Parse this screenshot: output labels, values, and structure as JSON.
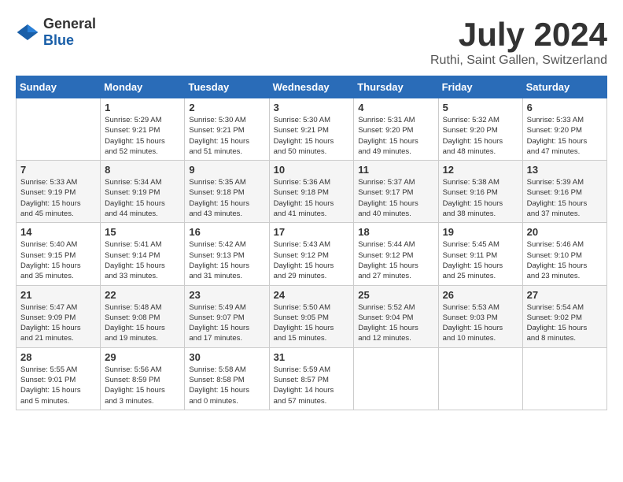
{
  "logo": {
    "general": "General",
    "blue": "Blue"
  },
  "title": "July 2024",
  "location": "Ruthi, Saint Gallen, Switzerland",
  "weekdays": [
    "Sunday",
    "Monday",
    "Tuesday",
    "Wednesday",
    "Thursday",
    "Friday",
    "Saturday"
  ],
  "weeks": [
    [
      {
        "day": "",
        "info": ""
      },
      {
        "day": "1",
        "info": "Sunrise: 5:29 AM\nSunset: 9:21 PM\nDaylight: 15 hours\nand 52 minutes."
      },
      {
        "day": "2",
        "info": "Sunrise: 5:30 AM\nSunset: 9:21 PM\nDaylight: 15 hours\nand 51 minutes."
      },
      {
        "day": "3",
        "info": "Sunrise: 5:30 AM\nSunset: 9:21 PM\nDaylight: 15 hours\nand 50 minutes."
      },
      {
        "day": "4",
        "info": "Sunrise: 5:31 AM\nSunset: 9:20 PM\nDaylight: 15 hours\nand 49 minutes."
      },
      {
        "day": "5",
        "info": "Sunrise: 5:32 AM\nSunset: 9:20 PM\nDaylight: 15 hours\nand 48 minutes."
      },
      {
        "day": "6",
        "info": "Sunrise: 5:33 AM\nSunset: 9:20 PM\nDaylight: 15 hours\nand 47 minutes."
      }
    ],
    [
      {
        "day": "7",
        "info": "Sunrise: 5:33 AM\nSunset: 9:19 PM\nDaylight: 15 hours\nand 45 minutes."
      },
      {
        "day": "8",
        "info": "Sunrise: 5:34 AM\nSunset: 9:19 PM\nDaylight: 15 hours\nand 44 minutes."
      },
      {
        "day": "9",
        "info": "Sunrise: 5:35 AM\nSunset: 9:18 PM\nDaylight: 15 hours\nand 43 minutes."
      },
      {
        "day": "10",
        "info": "Sunrise: 5:36 AM\nSunset: 9:18 PM\nDaylight: 15 hours\nand 41 minutes."
      },
      {
        "day": "11",
        "info": "Sunrise: 5:37 AM\nSunset: 9:17 PM\nDaylight: 15 hours\nand 40 minutes."
      },
      {
        "day": "12",
        "info": "Sunrise: 5:38 AM\nSunset: 9:16 PM\nDaylight: 15 hours\nand 38 minutes."
      },
      {
        "day": "13",
        "info": "Sunrise: 5:39 AM\nSunset: 9:16 PM\nDaylight: 15 hours\nand 37 minutes."
      }
    ],
    [
      {
        "day": "14",
        "info": "Sunrise: 5:40 AM\nSunset: 9:15 PM\nDaylight: 15 hours\nand 35 minutes."
      },
      {
        "day": "15",
        "info": "Sunrise: 5:41 AM\nSunset: 9:14 PM\nDaylight: 15 hours\nand 33 minutes."
      },
      {
        "day": "16",
        "info": "Sunrise: 5:42 AM\nSunset: 9:13 PM\nDaylight: 15 hours\nand 31 minutes."
      },
      {
        "day": "17",
        "info": "Sunrise: 5:43 AM\nSunset: 9:12 PM\nDaylight: 15 hours\nand 29 minutes."
      },
      {
        "day": "18",
        "info": "Sunrise: 5:44 AM\nSunset: 9:12 PM\nDaylight: 15 hours\nand 27 minutes."
      },
      {
        "day": "19",
        "info": "Sunrise: 5:45 AM\nSunset: 9:11 PM\nDaylight: 15 hours\nand 25 minutes."
      },
      {
        "day": "20",
        "info": "Sunrise: 5:46 AM\nSunset: 9:10 PM\nDaylight: 15 hours\nand 23 minutes."
      }
    ],
    [
      {
        "day": "21",
        "info": "Sunrise: 5:47 AM\nSunset: 9:09 PM\nDaylight: 15 hours\nand 21 minutes."
      },
      {
        "day": "22",
        "info": "Sunrise: 5:48 AM\nSunset: 9:08 PM\nDaylight: 15 hours\nand 19 minutes."
      },
      {
        "day": "23",
        "info": "Sunrise: 5:49 AM\nSunset: 9:07 PM\nDaylight: 15 hours\nand 17 minutes."
      },
      {
        "day": "24",
        "info": "Sunrise: 5:50 AM\nSunset: 9:05 PM\nDaylight: 15 hours\nand 15 minutes."
      },
      {
        "day": "25",
        "info": "Sunrise: 5:52 AM\nSunset: 9:04 PM\nDaylight: 15 hours\nand 12 minutes."
      },
      {
        "day": "26",
        "info": "Sunrise: 5:53 AM\nSunset: 9:03 PM\nDaylight: 15 hours\nand 10 minutes."
      },
      {
        "day": "27",
        "info": "Sunrise: 5:54 AM\nSunset: 9:02 PM\nDaylight: 15 hours\nand 8 minutes."
      }
    ],
    [
      {
        "day": "28",
        "info": "Sunrise: 5:55 AM\nSunset: 9:01 PM\nDaylight: 15 hours\nand 5 minutes."
      },
      {
        "day": "29",
        "info": "Sunrise: 5:56 AM\nSunset: 8:59 PM\nDaylight: 15 hours\nand 3 minutes."
      },
      {
        "day": "30",
        "info": "Sunrise: 5:58 AM\nSunset: 8:58 PM\nDaylight: 15 hours\nand 0 minutes."
      },
      {
        "day": "31",
        "info": "Sunrise: 5:59 AM\nSunset: 8:57 PM\nDaylight: 14 hours\nand 57 minutes."
      },
      {
        "day": "",
        "info": ""
      },
      {
        "day": "",
        "info": ""
      },
      {
        "day": "",
        "info": ""
      }
    ]
  ]
}
